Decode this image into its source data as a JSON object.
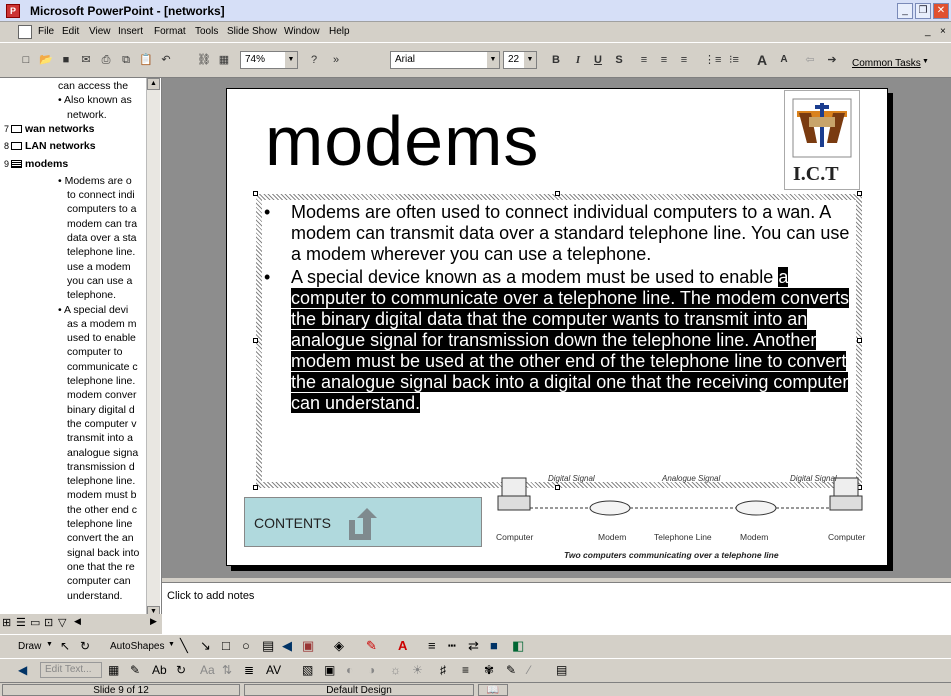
{
  "window": {
    "title": "Microsoft PowerPoint - [networks]",
    "app_icon": "powerpoint-icon",
    "buttons": [
      "minimize-icon",
      "restore-icon",
      "close-icon"
    ],
    "inner_buttons": [
      "_",
      "×"
    ]
  },
  "menu": [
    "File",
    "Edit",
    "View",
    "Insert",
    "Format",
    "Tools",
    "Slide Show",
    "Window",
    "Help"
  ],
  "toolbar": {
    "zoom": "74%",
    "font": "Arial",
    "font_size": "22",
    "bold": "B",
    "italic": "I",
    "underline": "U",
    "shadow": "S",
    "increase_font": "A",
    "decrease_font": "A",
    "common_tasks": "Common Tasks"
  },
  "outline": {
    "rows": [
      {
        "text": "can access the",
        "kind": "sub"
      },
      {
        "text": "• Also known as",
        "kind": "sub"
      },
      {
        "text": "network.",
        "kind": "subcont"
      },
      {
        "num": "7",
        "text": "wan networks",
        "kind": "slide"
      },
      {
        "num": "8",
        "text": "LAN networks",
        "kind": "slide"
      },
      {
        "num": "9",
        "text": "modems",
        "kind": "slide-current"
      },
      {
        "text": "• Modems are o",
        "kind": "sub"
      },
      {
        "text": "to connect indi",
        "kind": "subcont"
      },
      {
        "text": "computers to a",
        "kind": "subcont"
      },
      {
        "text": "modem can tra",
        "kind": "subcont"
      },
      {
        "text": "data over a sta",
        "kind": "subcont"
      },
      {
        "text": "telephone line.",
        "kind": "subcont"
      },
      {
        "text": "use a modem",
        "kind": "subcont"
      },
      {
        "text": "you can use a",
        "kind": "subcont"
      },
      {
        "text": "telephone.",
        "kind": "subcont"
      },
      {
        "text": "• A special devi",
        "kind": "sub"
      },
      {
        "text": "as a modem m",
        "kind": "subcont"
      },
      {
        "text": "used to enable",
        "kind": "subcont"
      },
      {
        "text": "computer to",
        "kind": "subcont"
      },
      {
        "text": "communicate c",
        "kind": "subcont"
      },
      {
        "text": "telephone line.",
        "kind": "subcont"
      },
      {
        "text": "modem conver",
        "kind": "subcont"
      },
      {
        "text": "binary digital d",
        "kind": "subcont"
      },
      {
        "text": "the computer v",
        "kind": "subcont"
      },
      {
        "text": "transmit into a",
        "kind": "subcont"
      },
      {
        "text": "analogue signa",
        "kind": "subcont"
      },
      {
        "text": "transmission d",
        "kind": "subcont"
      },
      {
        "text": "telephone line.",
        "kind": "subcont"
      },
      {
        "text": "modem must b",
        "kind": "subcont"
      },
      {
        "text": "the other end c",
        "kind": "subcont"
      },
      {
        "text": "telephone line",
        "kind": "subcont"
      },
      {
        "text": "convert the an",
        "kind": "subcont"
      },
      {
        "text": "signal back into",
        "kind": "subcont"
      },
      {
        "text": "one that the re",
        "kind": "subcont"
      },
      {
        "text": "computer can",
        "kind": "subcont"
      },
      {
        "text": "understand.",
        "kind": "subcont"
      }
    ]
  },
  "slide": {
    "title": "modems",
    "logo_text": "I.C.T",
    "bullet1": "Modems are often used to connect individual computers to a wan. A modem can transmit data over a standard telephone line. You can use a modem wherever you can use a telephone.",
    "bullet2_lead": " A special device known as a modem must be used to enable",
    "bullet2_highlight": "a computer to communicate over a telephone line. The modem converts the binary digital data that the computer wants to transmit into an analogue signal for transmission down the telephone line. Another modem must be used at the other end of the telephone line to convert the analogue signal back into a digital one that the receiving computer can understand.",
    "contents_label": "CONTENTS",
    "diagram": {
      "signal_left": "Digital Signal",
      "signal_mid": "Analogue Signal",
      "signal_right": "Digital Signal",
      "labels": [
        "Computer",
        "Modem",
        "Telephone Line",
        "Modem",
        "Computer"
      ],
      "caption": "Two computers communicating over a telephone line"
    }
  },
  "notes": {
    "placeholder": "Click to add notes"
  },
  "drawing_toolbar": {
    "draw": "Draw",
    "autoshapes": "AutoShapes"
  },
  "format_toolbar": {
    "edit_text": "Edit Text..."
  },
  "status": {
    "slide": "Slide 9 of 12",
    "design": "Default Design"
  }
}
